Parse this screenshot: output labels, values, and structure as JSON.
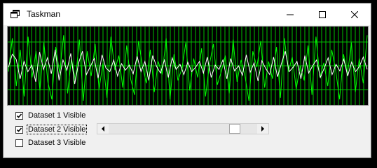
{
  "window": {
    "title": "Taskman"
  },
  "titlebar_icons": {
    "app": "app-window-icon",
    "minimize": "minimize-icon",
    "maximize": "maximize-icon",
    "close": "close-icon"
  },
  "plot": {
    "colors": {
      "background": "#000000",
      "grid": "#00c000",
      "series_white": "#ffffff",
      "series_green": "#00ff00"
    },
    "series_white": [
      52,
      34,
      41,
      68,
      44,
      58,
      49,
      72,
      31,
      55,
      39,
      61,
      28,
      70,
      42,
      56,
      33,
      75,
      46,
      30,
      62,
      51,
      40,
      67,
      35,
      53,
      58,
      42,
      64,
      47,
      56,
      49,
      61,
      37,
      58,
      44,
      70,
      36,
      51,
      60,
      42,
      66,
      39,
      55,
      48,
      62,
      45,
      58,
      52,
      44,
      60,
      38,
      66,
      49,
      55,
      42,
      68,
      40,
      57,
      50,
      63,
      35,
      59,
      46,
      71,
      43,
      54,
      62,
      38,
      65,
      47,
      30,
      58,
      52,
      44,
      68,
      36,
      60,
      50,
      42,
      66,
      53,
      39,
      62,
      48,
      57,
      41,
      64,
      45,
      58,
      51,
      38,
      55
    ],
    "series_green": [
      58,
      12,
      78,
      28,
      92,
      10,
      66,
      30,
      84,
      18,
      72,
      96,
      24,
      60,
      8,
      88,
      40,
      70,
      14,
      98,
      30,
      64,
      20,
      82,
      46,
      94,
      10,
      56,
      36,
      80,
      22,
      68,
      90,
      16,
      50,
      74,
      28,
      86,
      44,
      62,
      12,
      96,
      34,
      70,
      54,
      18,
      84,
      40,
      66,
      26,
      92,
      48,
      20,
      76,
      58,
      36,
      88,
      14,
      72,
      42,
      64,
      98,
      30,
      52,
      16,
      80,
      44,
      68,
      24,
      94,
      12,
      58,
      38,
      82,
      50,
      70,
      22,
      90,
      10,
      66,
      46,
      78,
      28,
      56,
      96,
      34,
      62,
      18,
      86,
      40,
      74,
      8
    ]
  },
  "controls": {
    "checkboxes": [
      {
        "label": "Dataset 1 Visible",
        "checked": true
      },
      {
        "label": "Dataset 2 Visible",
        "checked": true
      },
      {
        "label": "Dataset 3 Visible",
        "checked": false
      }
    ],
    "scrollbar": {
      "value_fraction": 1.0,
      "left_arrow": "arrow-left-icon",
      "right_arrow": "arrow-right-icon"
    }
  }
}
